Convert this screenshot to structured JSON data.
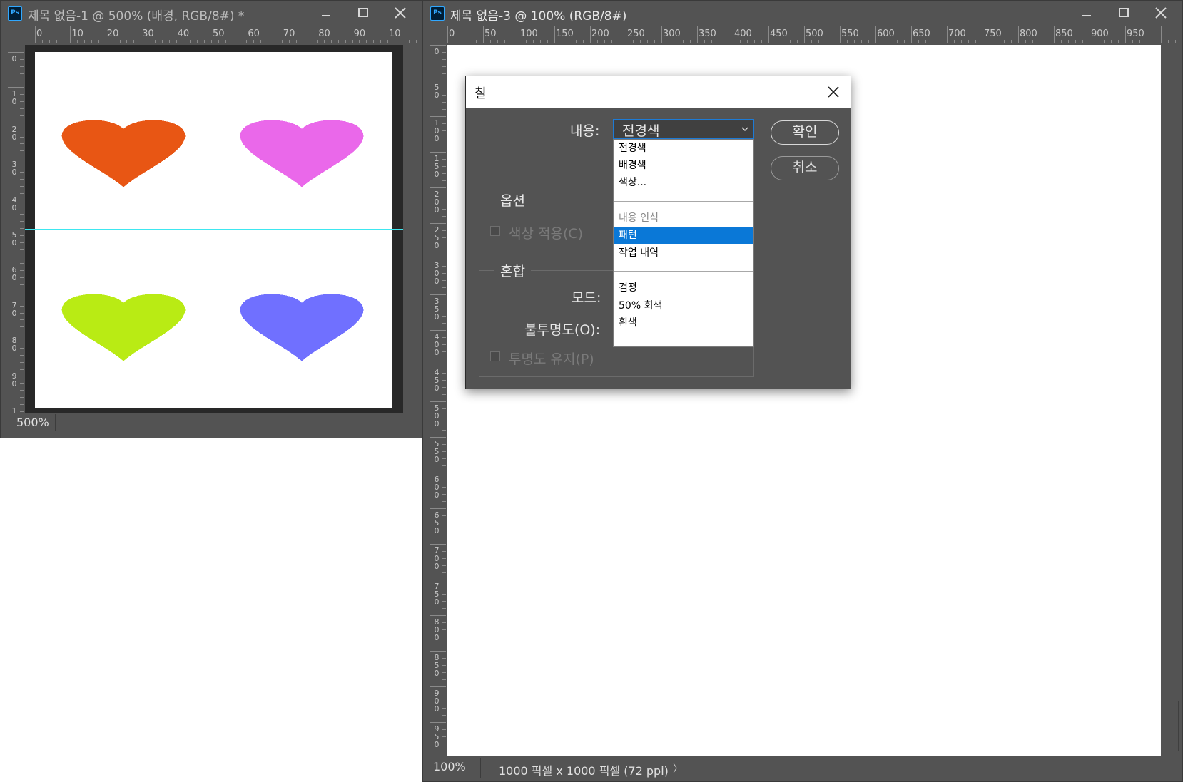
{
  "windows": [
    {
      "title": "제목 없음-1 @ 500% (배경, RGB/8#) *",
      "app_icon": "Ps",
      "ruler_h_labels": [
        "0",
        "10",
        "20",
        "30",
        "40",
        "50",
        "60",
        "70",
        "80",
        "90",
        "10"
      ],
      "ruler_v_labels": [
        "0",
        "10",
        "20",
        "30",
        "40",
        "50",
        "60",
        "70",
        "80",
        "90",
        "1"
      ],
      "zoom": "500%",
      "hearts": [
        {
          "color": "#e85614"
        },
        {
          "color": "#ea68ea"
        },
        {
          "color": "#b9eb14"
        },
        {
          "color": "#7070ff"
        }
      ]
    },
    {
      "title": "제목 없음-3 @ 100% (RGB/8#)",
      "app_icon": "Ps",
      "ruler_h_labels": [
        "0",
        "50",
        "100",
        "150",
        "200",
        "250",
        "300",
        "350",
        "400",
        "450",
        "500",
        "550",
        "600",
        "650",
        "700",
        "750",
        "800",
        "850",
        "900",
        "950"
      ],
      "ruler_v_labels": [
        "0",
        "50",
        "100",
        "150",
        "200",
        "250",
        "300",
        "350",
        "400",
        "450",
        "500",
        "550",
        "600",
        "650",
        "700",
        "750",
        "800",
        "850",
        "900",
        "950"
      ],
      "zoom": "100%",
      "doc_info": "1000 픽셀 x 1000 픽셀 (72 ppi)",
      "arrow": "〉"
    }
  ],
  "dialog": {
    "title": "칠",
    "content_label": "내용:",
    "content_value": "전경색",
    "options_group": "옵션",
    "color_adapt": "색상 적용(C)",
    "blend_group": "혼합",
    "mode_label": "모드:",
    "opacity_label": "불투명도(O):",
    "preserve_transparency": "투명도 유지(P)",
    "ok_label": "확인",
    "cancel_label": "취소",
    "dropdown_items": [
      {
        "label": "전경색",
        "state": "normal"
      },
      {
        "label": "배경색",
        "state": "normal"
      },
      {
        "label": "색상...",
        "state": "normal"
      },
      {
        "label": "내용 인식",
        "state": "disabled"
      },
      {
        "label": "패턴",
        "state": "selected"
      },
      {
        "label": "작업 내역",
        "state": "normal"
      },
      {
        "label": "검정",
        "state": "normal"
      },
      {
        "label": "50% 회색",
        "state": "normal"
      },
      {
        "label": "흰색",
        "state": "normal"
      }
    ]
  },
  "colors": {
    "chrome": "#535353",
    "pasteboard": "#282828",
    "guide": "#3ee7f0",
    "accent": "#0a78d7"
  }
}
